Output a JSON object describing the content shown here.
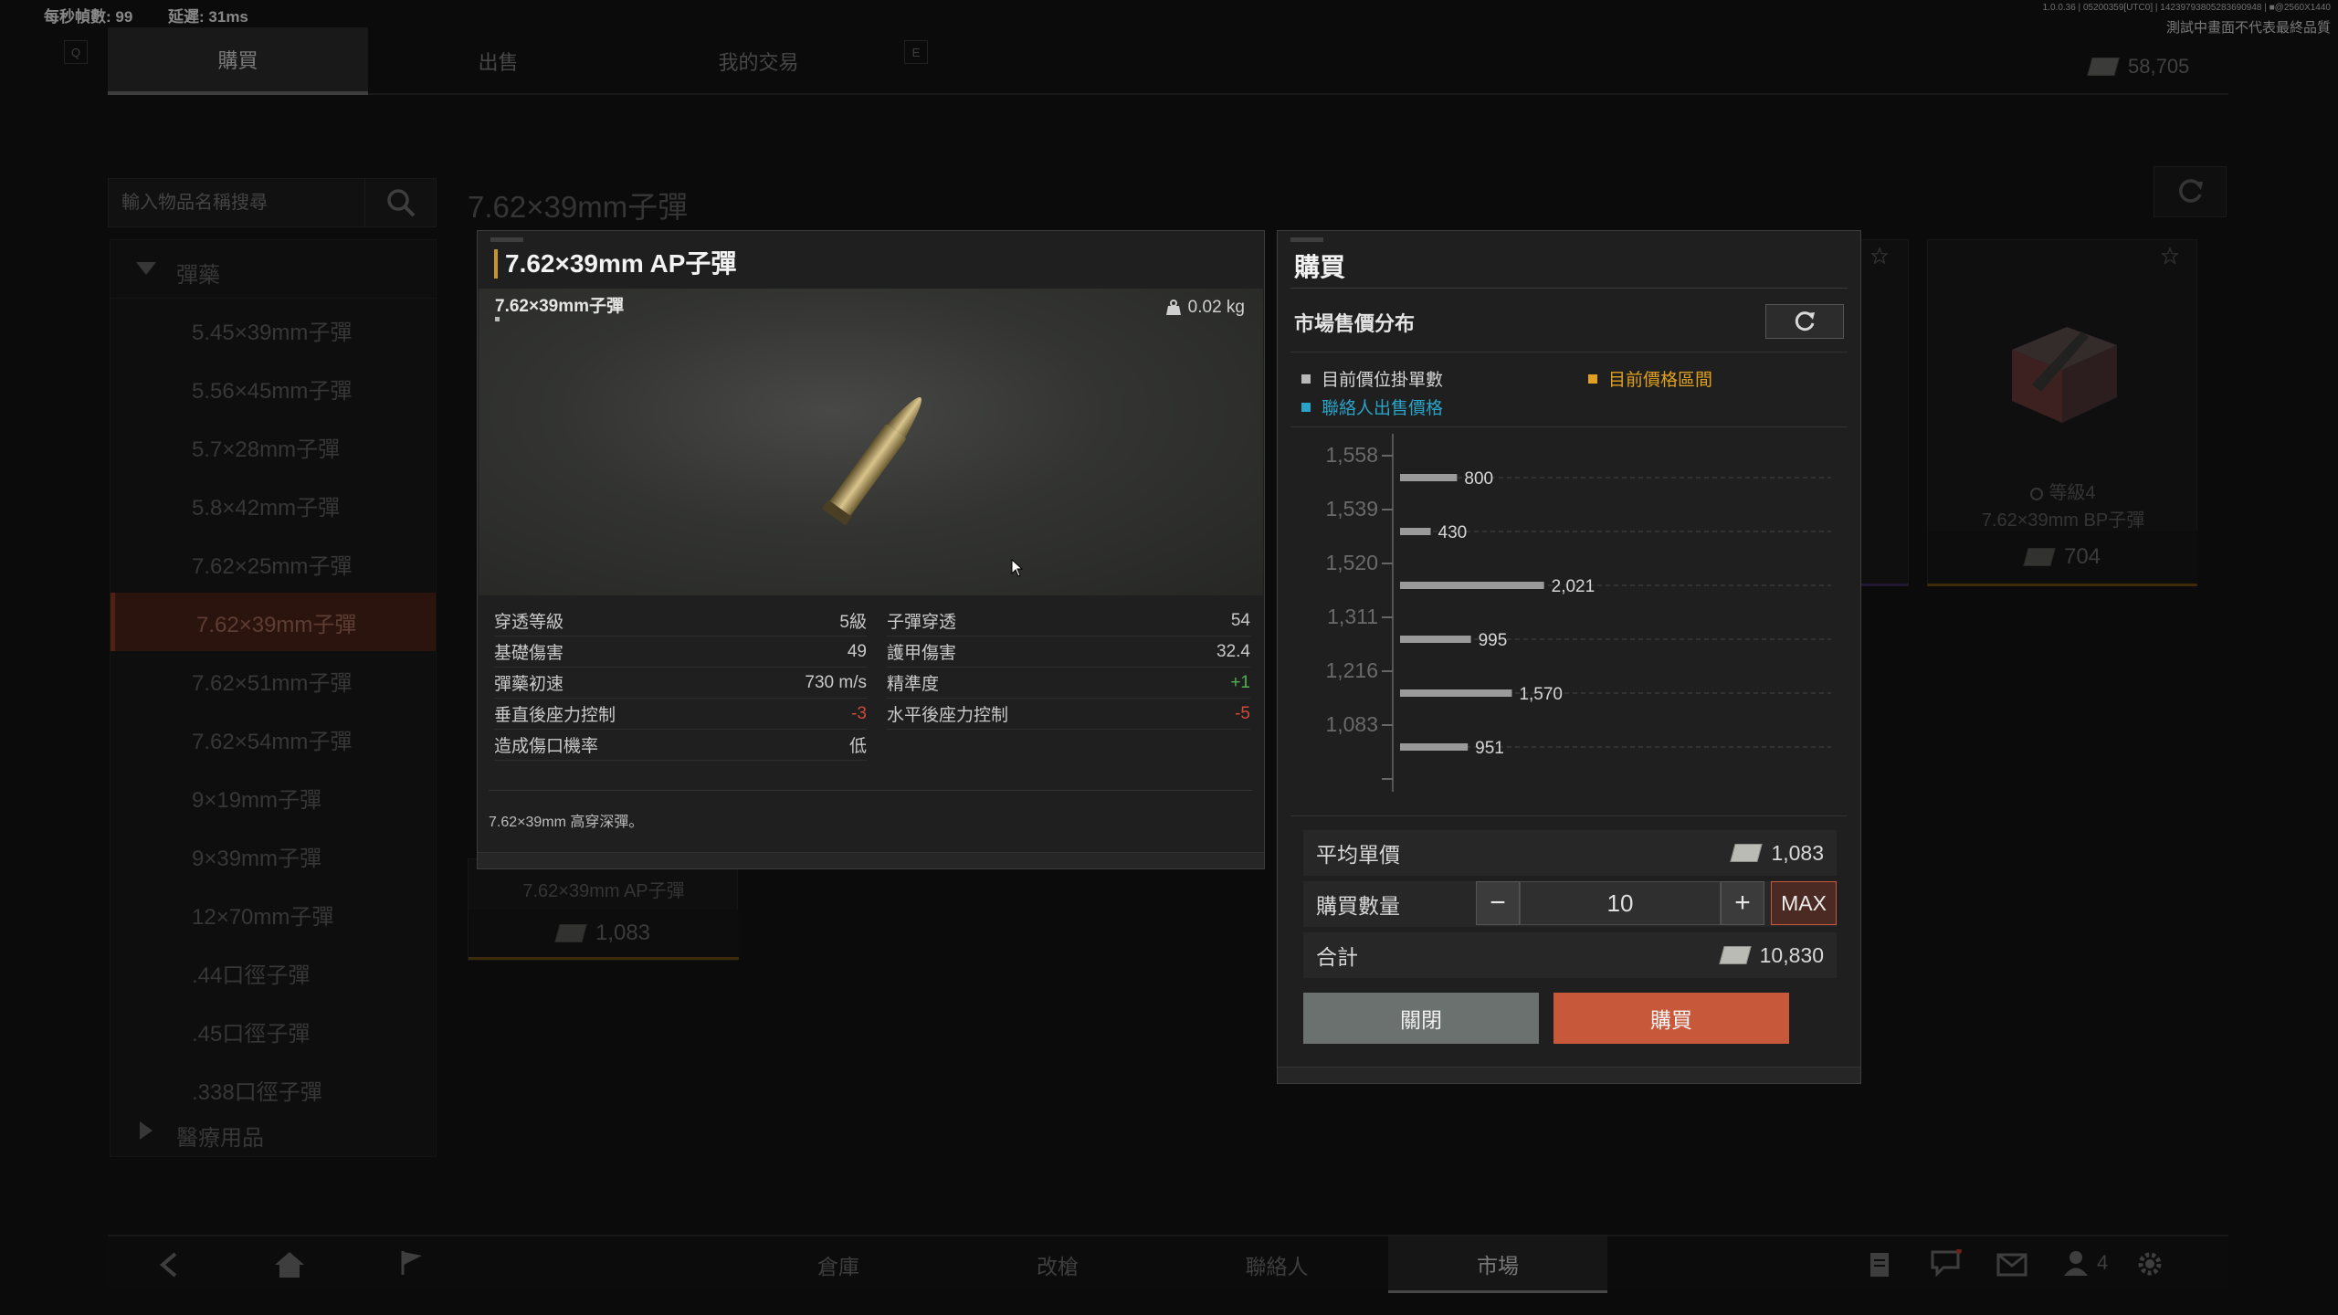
{
  "hud": {
    "fps_label": "每秒幀數:",
    "fps_value": "99",
    "latency_label": "延遲:",
    "latency_value": "31ms",
    "build_info": "1.0.0.36 | 05200359[UTC0] | 14239793805283690948 | ■@2560X1440",
    "test_notice": "測試中畫面不代表最終品質"
  },
  "top_nav": {
    "key_left": "Q",
    "key_right": "E",
    "tabs": [
      {
        "label": "購買",
        "active": true
      },
      {
        "label": "出售",
        "active": false
      },
      {
        "label": "我的交易",
        "active": false
      }
    ],
    "currency_amount": "58,705"
  },
  "search": {
    "placeholder": "輸入物品名稱搜尋"
  },
  "page_heading": "7.62×39mm子彈",
  "sidebar": {
    "category_open": "彈藥",
    "items": [
      {
        "label": "5.45×39mm子彈"
      },
      {
        "label": "5.56×45mm子彈"
      },
      {
        "label": "5.7×28mm子彈"
      },
      {
        "label": "5.8×42mm子彈"
      },
      {
        "label": "7.62×25mm子彈"
      },
      {
        "label": "7.62×39mm子彈",
        "active": true
      },
      {
        "label": "7.62×51mm子彈"
      },
      {
        "label": "7.62×54mm子彈"
      },
      {
        "label": "9×19mm子彈"
      },
      {
        "label": "9×39mm子彈"
      },
      {
        "label": "12×70mm子彈"
      },
      {
        "label": ".44口徑子彈"
      },
      {
        "label": ".45口徑子彈"
      },
      {
        "label": ".338口徑子彈"
      }
    ],
    "category_closed": "醫療用品"
  },
  "cards": {
    "ap_name": "7.62×39mm AP子彈",
    "ap_price": "1,083",
    "bp_grade": "等級4",
    "bp_name": "7.62×39mm BP子彈",
    "bp_price": "704"
  },
  "detail": {
    "title": "7.62×39mm AP子彈",
    "category": "7.62×39mm子彈",
    "weight": "0.02 kg",
    "stats_left": [
      {
        "label": "穿透等級",
        "value": "5級"
      },
      {
        "label": "基礎傷害",
        "value": "49"
      },
      {
        "label": "彈藥初速",
        "value": "730 m/s"
      },
      {
        "label": "垂直後座力控制",
        "value": "-3"
      },
      {
        "label": "造成傷口機率",
        "value": "低"
      }
    ],
    "stats_right": [
      {
        "label": "子彈穿透",
        "value": "54"
      },
      {
        "label": "護甲傷害",
        "value": "32.4"
      },
      {
        "label": "精準度",
        "value": "+1"
      },
      {
        "label": "水平後座力控制",
        "value": "-5"
      }
    ],
    "description": "7.62×39mm 高穿深彈。"
  },
  "buy": {
    "title": "購買",
    "market_heading": "市場售價分布",
    "legend": {
      "listings": "目前價位掛單數",
      "current_range": "目前價格區間",
      "contact_price": "聯絡人出售價格"
    },
    "colors": {
      "listings": "#b8b8b8",
      "current_range": "#e0a020",
      "contact_price": "#2aa3c8",
      "buy_button": "#c8583a"
    },
    "avg_label": "平均單價",
    "avg_value": "1,083",
    "qty_label": "購買數量",
    "qty_value": "10",
    "max_label": "MAX",
    "minus_label": "−",
    "plus_label": "+",
    "total_label": "合計",
    "total_value": "10,830",
    "close_label": "關閉",
    "buy_label": "購買"
  },
  "chart_data": {
    "type": "bar",
    "orientation": "horizontal",
    "categories": [
      "1,558",
      "1,539",
      "1,520",
      "1,311",
      "1,216",
      "1,083"
    ],
    "values": [
      800,
      430,
      2021,
      995,
      1570,
      951
    ],
    "value_labels": [
      "800",
      "430",
      "2,021",
      "995",
      "1,570",
      "951"
    ],
    "grid": true,
    "xlim": [
      0,
      6000
    ]
  },
  "bottom_nav": {
    "tabs": [
      {
        "label": "倉庫"
      },
      {
        "label": "改槍"
      },
      {
        "label": "聯絡人"
      },
      {
        "label": "市場",
        "active": true
      }
    ],
    "friends_count": "4"
  }
}
